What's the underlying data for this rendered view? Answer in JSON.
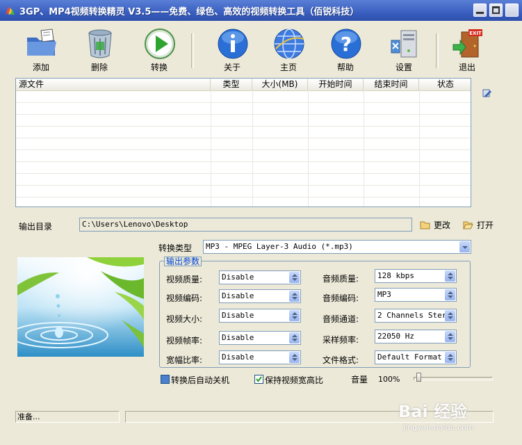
{
  "window": {
    "title": "3GP、MP4视频转换精灵 V3.5——免费、绿色、高效的视频转换工具（佰锐科技）"
  },
  "toolbar": {
    "add_label": "添加",
    "delete_label": "删除",
    "convert_label": "转换",
    "about_label": "关于",
    "home_label": "主页",
    "help_label": "帮助",
    "settings_label": "设置",
    "exit_label": "退出",
    "exit_sign_text": "EXIT"
  },
  "file_list": {
    "columns": [
      "源文件",
      "类型",
      "大小(MB)",
      "开始时间",
      "结束时间",
      "状态"
    ]
  },
  "output_dir": {
    "label": "输出目录",
    "value": "C:\\Users\\Lenovo\\Desktop",
    "change_label": "更改",
    "open_label": "打开"
  },
  "convert_type": {
    "label": "转换类型",
    "value": "MP3 - MPEG Layer-3 Audio (*.mp3)"
  },
  "output_params": {
    "title": "输出参数",
    "video_quality_label": "视频质量:",
    "video_quality_value": "Disable",
    "video_codec_label": "视频编码:",
    "video_codec_value": "Disable",
    "video_size_label": "视频大小:",
    "video_size_value": "Disable",
    "frame_rate_label": "视频帧率:",
    "frame_rate_value": "Disable",
    "aspect_label": "宽幅比率:",
    "aspect_value": "Disable",
    "audio_quality_label": "音频质量:",
    "audio_quality_value": "128 kbps",
    "audio_codec_label": "音频编码:",
    "audio_codec_value": "MP3",
    "audio_channels_label": "音频通道:",
    "audio_channels_value": "2 Channels Stere",
    "sample_rate_label": "采样频率:",
    "sample_rate_value": "22050 Hz",
    "file_format_label": "文件格式:",
    "file_format_value": "Default Format"
  },
  "options": {
    "auto_shutdown_label": "转换后自动关机",
    "auto_shutdown_checked": false,
    "keep_aspect_label": "保持视频宽高比",
    "keep_aspect_checked": true,
    "volume_label": "音量",
    "volume_value": "100%",
    "volume_level": 1.0
  },
  "status": {
    "text": "准备..."
  },
  "watermark": {
    "text": "Bai 经验",
    "url": "jingyan.baidu.com"
  },
  "colors": {
    "titlebar": "#3a5fc0",
    "face": "#ece9d8",
    "accent": "#0046d5"
  }
}
